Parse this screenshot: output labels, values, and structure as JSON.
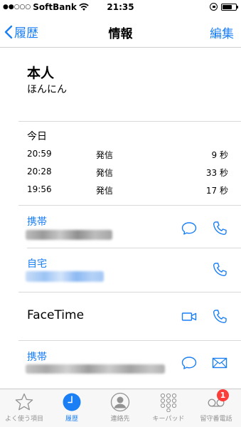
{
  "status_bar": {
    "signal_dots": "●●○○○",
    "carrier": "SoftBank",
    "time": "21:35"
  },
  "nav": {
    "back_label": "履歴",
    "title": "情報",
    "edit_label": "編集"
  },
  "contact": {
    "name": "本人",
    "reading": "ほんにん"
  },
  "recents": {
    "title": "今日",
    "calls": [
      {
        "time": "20:59",
        "type": "発信",
        "duration": "9 秒"
      },
      {
        "time": "20:28",
        "type": "発信",
        "duration": "33 秒"
      },
      {
        "time": "19:56",
        "type": "発信",
        "duration": "17 秒"
      }
    ]
  },
  "fields": {
    "mobile_label": "携帯",
    "home_label": "自宅",
    "facetime_label": "FaceTime",
    "mobile2_label": "携帯"
  },
  "tabs": [
    {
      "label": "よく使う項目",
      "icon": "star-icon"
    },
    {
      "label": "履歴",
      "icon": "clock-icon"
    },
    {
      "label": "連絡先",
      "icon": "contacts-icon"
    },
    {
      "label": "キーパッド",
      "icon": "keypad-icon"
    },
    {
      "label": "留守番電話",
      "icon": "voicemail-icon",
      "badge": "1"
    }
  ],
  "colors": {
    "accent": "#1a7ff5",
    "badge": "#fc3d39",
    "tab_inactive": "#929292"
  }
}
